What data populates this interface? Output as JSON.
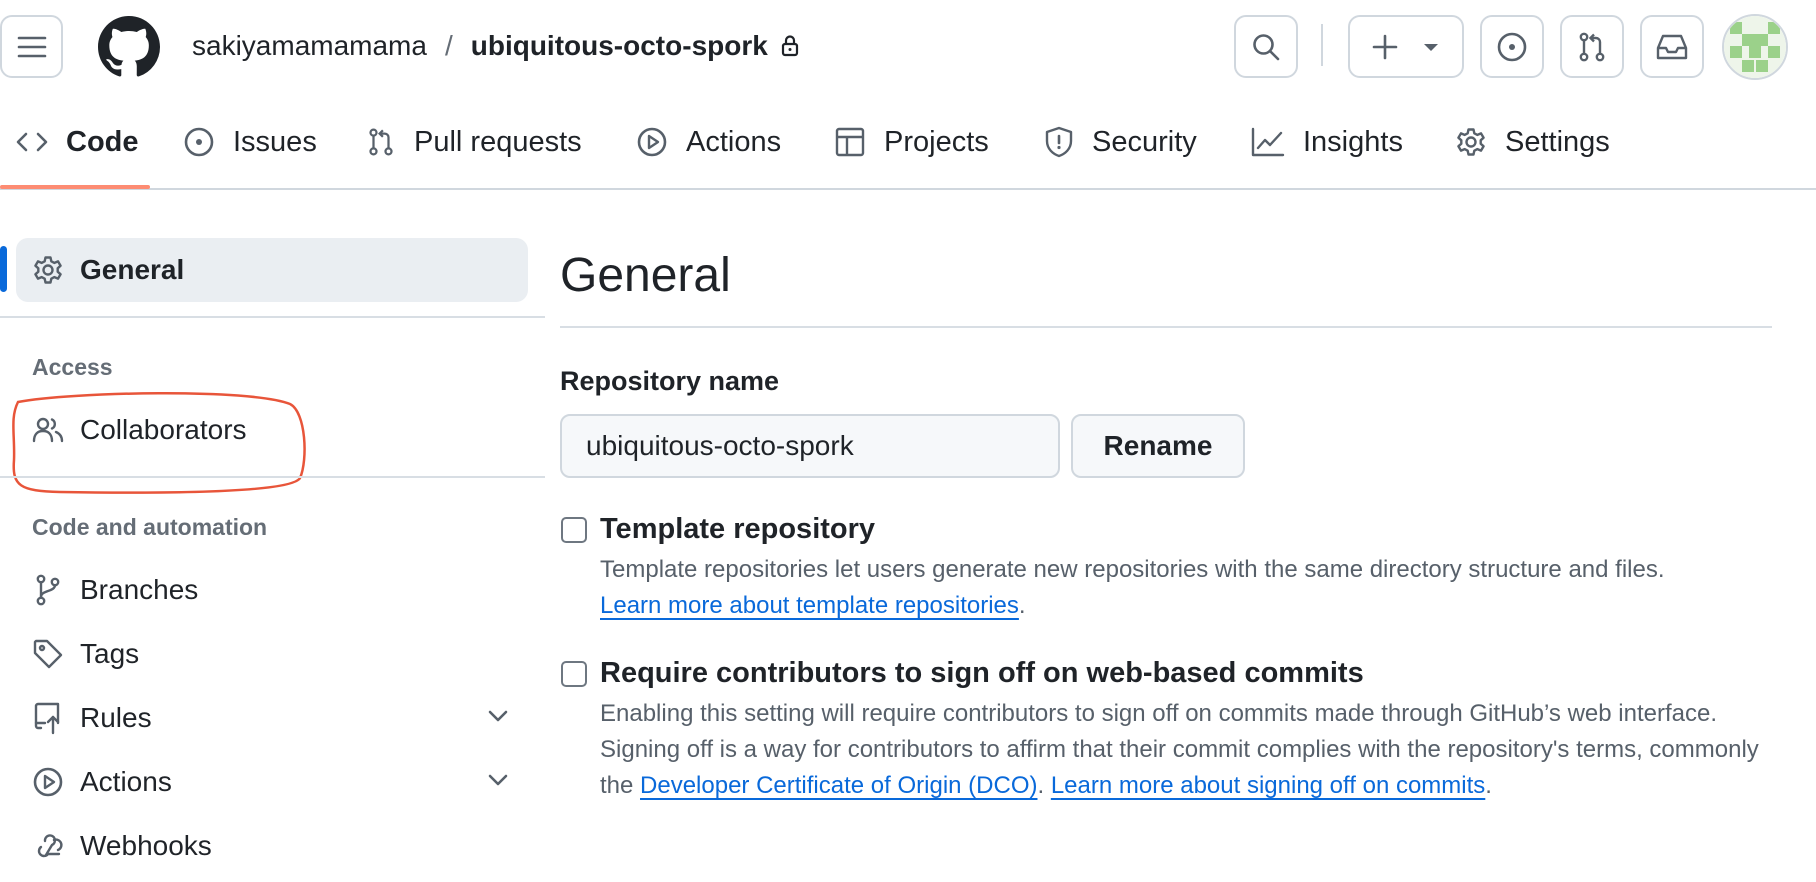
{
  "header": {
    "owner": "sakiyamamamama",
    "separator": "/",
    "repo_name": "ubiquitous-octo-spork"
  },
  "repo_nav": {
    "tabs": [
      {
        "label": "Code",
        "icon": "code-icon",
        "active": true
      },
      {
        "label": "Issues",
        "icon": "issue-opened-icon"
      },
      {
        "label": "Pull requests",
        "icon": "git-pull-request-icon"
      },
      {
        "label": "Actions",
        "icon": "play-icon"
      },
      {
        "label": "Projects",
        "icon": "table-icon"
      },
      {
        "label": "Security",
        "icon": "shield-icon"
      },
      {
        "label": "Insights",
        "icon": "graph-icon"
      },
      {
        "label": "Settings",
        "icon": "gear-icon"
      }
    ]
  },
  "sidebar": {
    "general": "General",
    "access_heading": "Access",
    "collaborators": "Collaborators",
    "code_heading": "Code and automation",
    "items": [
      {
        "label": "Branches",
        "icon": "git-branch-icon"
      },
      {
        "label": "Tags",
        "icon": "tag-icon"
      },
      {
        "label": "Rules",
        "icon": "repo-push-icon",
        "expandable": true
      },
      {
        "label": "Actions",
        "icon": "play-icon",
        "expandable": true
      },
      {
        "label": "Webhooks",
        "icon": "webhook-icon"
      }
    ]
  },
  "main": {
    "title": "General",
    "repo_name_label": "Repository name",
    "repo_name_value": "ubiquitous-octo-spork",
    "rename_button": "Rename",
    "template": {
      "title": "Template repository",
      "desc": "Template repositories let users generate new repositories with the same directory structure and files.",
      "link": "Learn more about template repositories",
      "after_link": "."
    },
    "signoff": {
      "title": "Require contributors to sign off on web-based commits",
      "desc": "Enabling this setting will require contributors to sign off on commits made through GitHub’s web interface. Signing off is a way for contributors to affirm that their commit complies with the repository's terms, commonly the ",
      "link1": "Developer Certificate of Origin (DCO)",
      "between": ". ",
      "link2": "Learn more about signing off on commits",
      "after": "."
    }
  },
  "colors": {
    "accent": "#0969da",
    "tab_underline": "#fd8c73",
    "annotation": "#e8553a",
    "avatar": "#9bd18a"
  }
}
